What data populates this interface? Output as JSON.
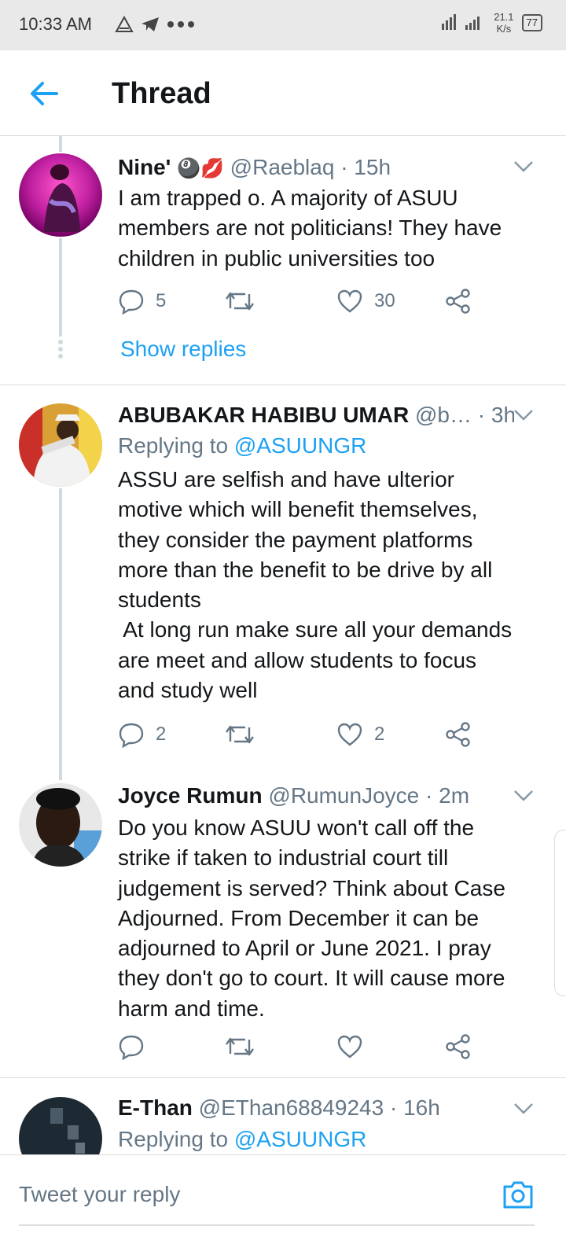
{
  "status_bar": {
    "time": "10:33 AM",
    "network_speed_value": "21.1",
    "network_speed_unit": "K/s",
    "battery": "77"
  },
  "header": {
    "title": "Thread"
  },
  "tweets": [
    {
      "name": "Nine'",
      "emoji": "🎱💋",
      "handle": "@Raeblaq",
      "dot": "·",
      "time": "15h",
      "text": [
        "I am trapped o. A majority of ASUU",
        "members are not politicians! They have",
        "children in public universities too"
      ],
      "replies": "5",
      "retweets": "",
      "likes": "30",
      "show_replies": "Show replies"
    },
    {
      "name": "ABUBAKAR HABIBU UMAR",
      "handle": "@b…",
      "dot": "·",
      "time": "3h",
      "replying_prefix": "Replying to",
      "replying_handle": "@ASUUNGR",
      "text": [
        "ASSU are selfish and have ulterior",
        "motive which will benefit themselves,",
        "they consider the payment platforms",
        "more than the benefit to be drive by all",
        "students",
        " At long run make sure all your demands",
        "are meet and allow students to focus",
        "and study well"
      ],
      "replies": "2",
      "retweets": "",
      "likes": "2"
    },
    {
      "name": "Joyce Rumun",
      "handle": "@RumunJoyce",
      "dot": "·",
      "time": "2m",
      "text": [
        "Do you know ASUU won't call off the",
        "strike if taken to industrial court till",
        "judgement is served? Think about Case",
        "Adjourned. From December it can be",
        "adjourned to April or June 2021. I pray",
        "they don't go to court. It will cause more",
        "harm and time."
      ],
      "replies": "",
      "retweets": "",
      "likes": ""
    },
    {
      "name": "E-Than",
      "handle": "@EThan68849243",
      "dot": "·",
      "time": "16h",
      "replying_prefix": "Replying to",
      "replying_handle": "@ASUUNGR"
    }
  ],
  "reply_bar": {
    "placeholder": "Tweet your reply"
  },
  "colors": {
    "accent": "#1da1f2",
    "muted": "#657786",
    "text": "#14171a",
    "divider": "#dcdcdc",
    "status_bg": "#e9e9e9"
  }
}
